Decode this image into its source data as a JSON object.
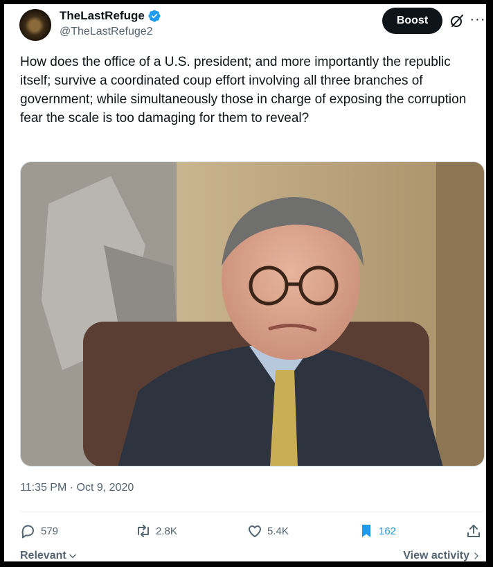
{
  "author": {
    "name": "TheLastRefuge",
    "handle": "@TheLastRefuge2",
    "verified_color": "#1d9bf0"
  },
  "header": {
    "boost_label": "Boost",
    "icons": [
      "grok-icon",
      "more-icon"
    ]
  },
  "post": {
    "text": "How does the office of a U.S. president; and more importantly the republic itself; survive a coordinated coup effort involving all three branches of government; while simultaneously those in charge of exposing the corruption fear the scale is too damaging for them to reveal?",
    "timestamp": "11:35 PM · Oct 9, 2020"
  },
  "actions": {
    "replies": "579",
    "reposts": "2.8K",
    "likes": "5.4K",
    "bookmarks": "162",
    "bookmark_color": "#1d9bf0"
  },
  "footer": {
    "relevant_label": "Relevant",
    "view_activity_label": "View activity"
  }
}
